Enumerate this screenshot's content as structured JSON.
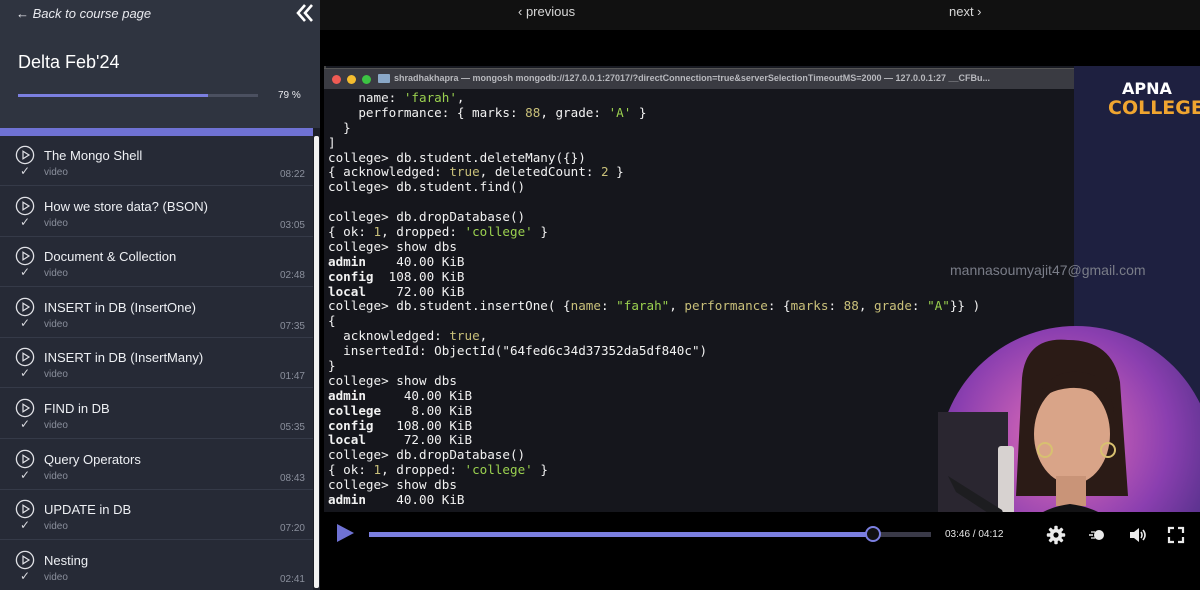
{
  "sidebar": {
    "back_label": "← Back to course page",
    "course_title": "Delta Feb'24",
    "progress_pct": 79,
    "progress_label": "79 %",
    "lessons": [
      {
        "title": "The Mongo Shell",
        "kind": "video",
        "duration": "08:22"
      },
      {
        "title": "How we store data? (BSON)",
        "kind": "video",
        "duration": "03:05"
      },
      {
        "title": "Document & Collection",
        "kind": "video",
        "duration": "02:48"
      },
      {
        "title": "INSERT in DB (InsertOne)",
        "kind": "video",
        "duration": "07:35"
      },
      {
        "title": "INSERT in DB (InsertMany)",
        "kind": "video",
        "duration": "01:47"
      },
      {
        "title": "FIND in DB",
        "kind": "video",
        "duration": "05:35"
      },
      {
        "title": "Query Operators",
        "kind": "video",
        "duration": "08:43"
      },
      {
        "title": "UPDATE in DB",
        "kind": "video",
        "duration": "07:20"
      },
      {
        "title": "Nesting",
        "kind": "video",
        "duration": "02:41"
      }
    ],
    "check_mark": "✓"
  },
  "nav": {
    "previous": "‹ previous",
    "next": "next ›"
  },
  "video": {
    "brand_line1": "APNA",
    "brand_line2": "COLLEGE",
    "watermark": "mannasoumyajit47@gmail.com",
    "terminal_title": "shradhakhapra — mongosh mongodb://127.0.0.1:27017/?directConnection=true&serverSelectionTimeoutMS=2000 — 127.0.0.1:27 __CFBu...",
    "terminal_lines": [
      [
        {
          "t": "    name: "
        },
        {
          "t": "'farah'",
          "c": "s"
        },
        {
          "t": ","
        }
      ],
      [
        {
          "t": "    performance: { marks: "
        },
        {
          "t": "88",
          "c": "n"
        },
        {
          "t": ", grade: "
        },
        {
          "t": "'A'",
          "c": "s"
        },
        {
          "t": " }"
        }
      ],
      [
        {
          "t": "  }"
        }
      ],
      [
        {
          "t": "]"
        }
      ],
      [
        {
          "t": "college> db.student.deleteMany({})"
        }
      ],
      [
        {
          "t": "{ acknowledged: "
        },
        {
          "t": "true",
          "c": "n"
        },
        {
          "t": ", deletedCount: "
        },
        {
          "t": "2",
          "c": "n"
        },
        {
          "t": " }"
        }
      ],
      [
        {
          "t": "college> db.student.find()"
        }
      ],
      [
        {
          "t": ""
        }
      ],
      [
        {
          "t": "college> db.dropDatabase()"
        }
      ],
      [
        {
          "t": "{ ok: "
        },
        {
          "t": "1",
          "c": "n"
        },
        {
          "t": ", dropped: "
        },
        {
          "t": "'college'",
          "c": "s"
        },
        {
          "t": " }"
        }
      ],
      [
        {
          "t": "college> show dbs"
        }
      ],
      [
        {
          "t": "admin",
          "c": "b"
        },
        {
          "t": "    40.00 KiB"
        }
      ],
      [
        {
          "t": "config",
          "c": "b"
        },
        {
          "t": "  108.00 KiB"
        }
      ],
      [
        {
          "t": "local",
          "c": "b"
        },
        {
          "t": "    72.00 KiB"
        }
      ],
      [
        {
          "t": "college> db.student.insertOne( {"
        },
        {
          "t": "name",
          "c": "k"
        },
        {
          "t": ": "
        },
        {
          "t": "\"farah\"",
          "c": "s"
        },
        {
          "t": ", "
        },
        {
          "t": "performance",
          "c": "k"
        },
        {
          "t": ": {"
        },
        {
          "t": "marks",
          "c": "k"
        },
        {
          "t": ": "
        },
        {
          "t": "88",
          "c": "n"
        },
        {
          "t": ", "
        },
        {
          "t": "grade",
          "c": "k"
        },
        {
          "t": ": "
        },
        {
          "t": "\"A\"",
          "c": "s"
        },
        {
          "t": "}} )"
        }
      ],
      [
        {
          "t": "{"
        }
      ],
      [
        {
          "t": "  acknowledged: "
        },
        {
          "t": "true",
          "c": "n"
        },
        {
          "t": ","
        }
      ],
      [
        {
          "t": "  insertedId: ObjectId(\"64fed6c34d37352da5df840c\")"
        }
      ],
      [
        {
          "t": "}"
        }
      ],
      [
        {
          "t": "college> show dbs"
        }
      ],
      [
        {
          "t": "admin",
          "c": "b"
        },
        {
          "t": "     40.00 KiB"
        }
      ],
      [
        {
          "t": "college",
          "c": "b"
        },
        {
          "t": "    8.00 KiB"
        }
      ],
      [
        {
          "t": "config",
          "c": "b"
        },
        {
          "t": "   108.00 KiB"
        }
      ],
      [
        {
          "t": "local",
          "c": "b"
        },
        {
          "t": "     72.00 KiB"
        }
      ],
      [
        {
          "t": "college> db.dropDatabase()"
        }
      ],
      [
        {
          "t": "{ ok: "
        },
        {
          "t": "1",
          "c": "n"
        },
        {
          "t": ", dropped: "
        },
        {
          "t": "'college'",
          "c": "s"
        },
        {
          "t": " }"
        }
      ],
      [
        {
          "t": "college> show dbs"
        }
      ],
      [
        {
          "t": "admin",
          "c": "b"
        },
        {
          "t": "    40.00 KiB"
        }
      ]
    ]
  },
  "player": {
    "current_time": "03:46",
    "duration": "04:12",
    "time_label": "03:46 / 04:12",
    "played_fraction": 0.897,
    "accent": "#7b7fe0"
  },
  "icons": {
    "collapse": "double-chevron-left-icon",
    "play": "play-icon",
    "settings": "gear-icon",
    "speed": "speed-icon",
    "volume": "volume-icon",
    "fullscreen": "fullscreen-icon"
  }
}
